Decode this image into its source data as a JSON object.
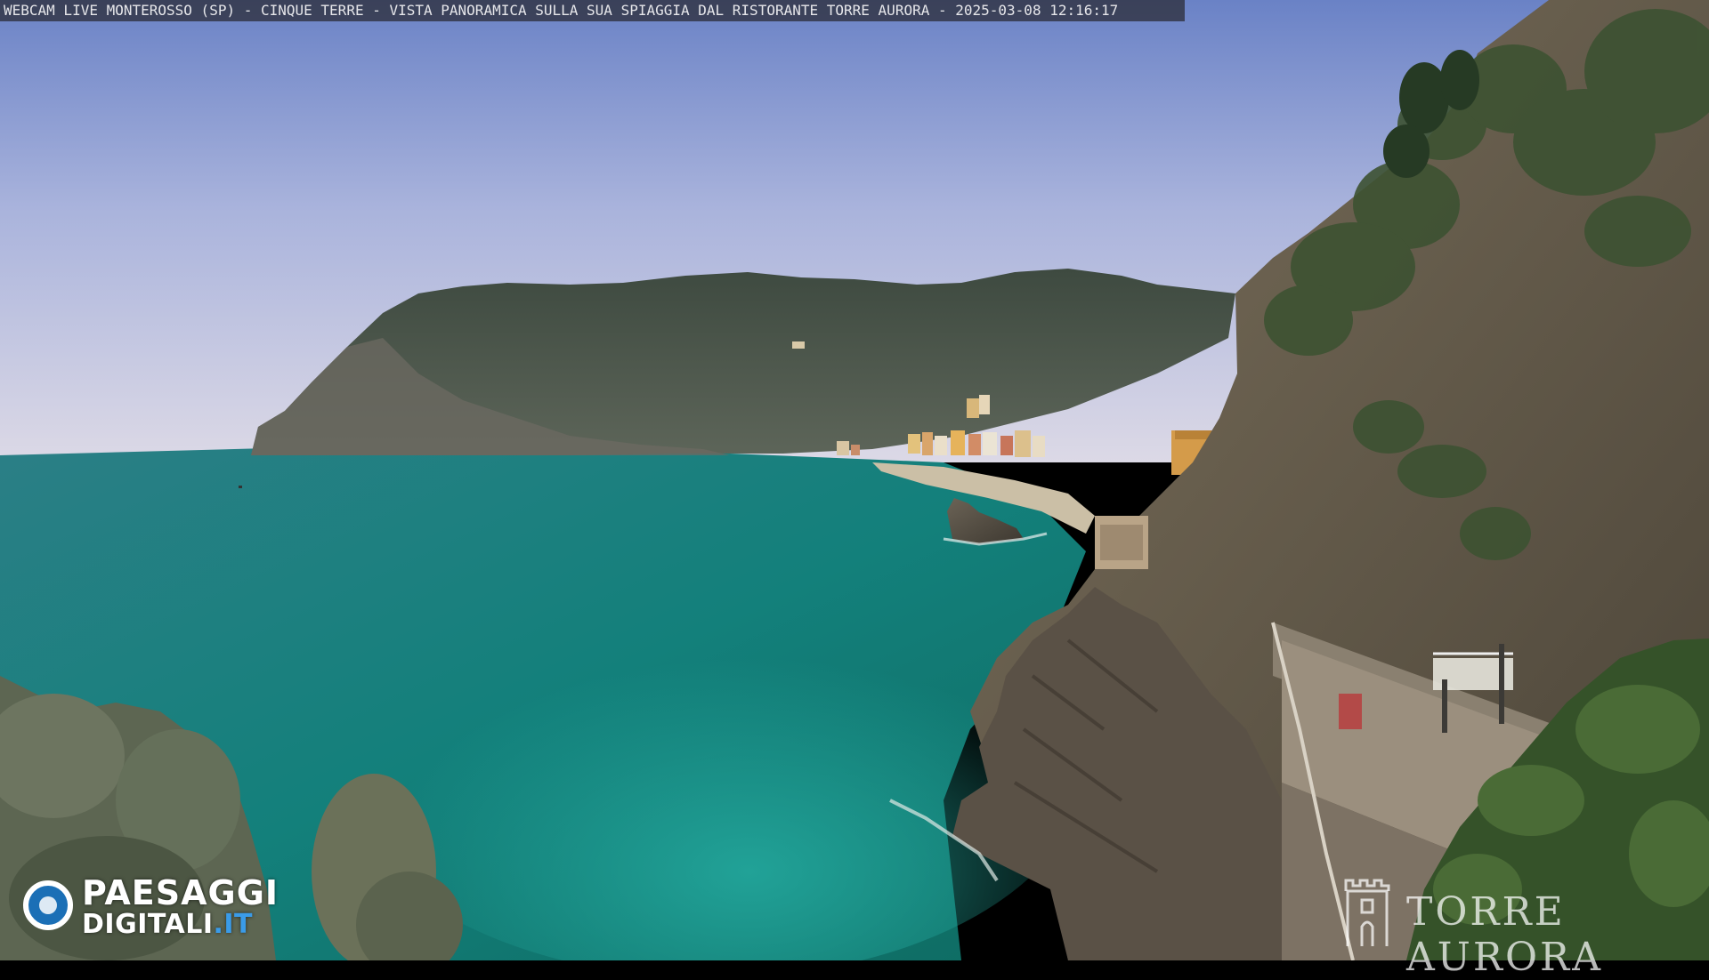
{
  "webcam": {
    "caption": "WEBCAM LIVE MONTEROSSO (SP) - CINQUE TERRE - VISTA PANORAMICA SULLA SUA SPIAGGIA DAL RISTORANTE TORRE AURORA - 2025-03-08 12:16:17"
  },
  "logos": {
    "provider_line1": "PAESAGGI",
    "provider_line2_main": "DIGITALI",
    "provider_line2_tld": ".IT",
    "venue": "TORRE AURORA"
  },
  "colors": {
    "sky_top": "#6f86c8",
    "sky_horizon": "#d7d7e6",
    "sea_deep": "#0f6f6f",
    "sea_light": "#1f9a94",
    "brand_blue": "#3a9be8"
  },
  "icons": [
    "camera-lens-icon",
    "tower-icon"
  ]
}
